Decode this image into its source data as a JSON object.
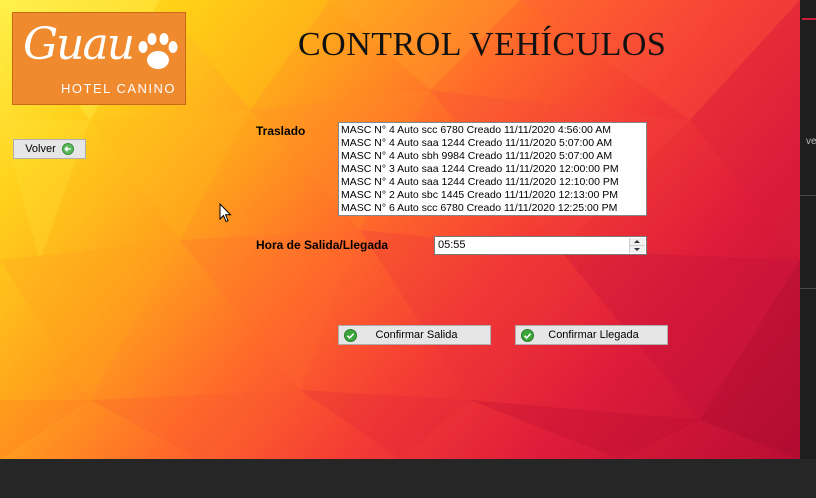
{
  "logo": {
    "brand": "Guau",
    "subtitle": "HOTEL CANINO",
    "icon": "paw-icon"
  },
  "title": "CONTROL VEHÍCULOS",
  "buttons": {
    "volver": "Volver",
    "confirmar_salida": "Confirmar Salida",
    "confirmar_llegada": "Confirmar Llegada"
  },
  "labels": {
    "traslado": "Traslado",
    "hora": "Hora de Salida/Llegada"
  },
  "traslado_items": [
    "MASC N° 4 Auto scc 6780 Creado 11/11/2020 4:56:00 AM",
    "MASC N° 4 Auto saa 1244 Creado 11/11/2020 5:07:00 AM",
    "MASC N° 4 Auto sbh 9984 Creado 11/11/2020 5:07:00 AM",
    "MASC N° 3 Auto saa 1244 Creado 11/11/2020 12:00:00 PM",
    "MASC N° 4 Auto saa 1244 Creado 11/11/2020 12:10:00 PM",
    "MASC N° 2 Auto sbc 1445 Creado 11/11/2020 12:13:00 PM",
    "MASC N° 6 Auto scc 6780 Creado 11/11/2020 12:25:00 PM"
  ],
  "time_value": "05:55",
  "side_panel_text": "ve",
  "colors": {
    "logo_bg": "#f08a2e",
    "accent": "#c81e3c",
    "check": "#3aa63a"
  }
}
